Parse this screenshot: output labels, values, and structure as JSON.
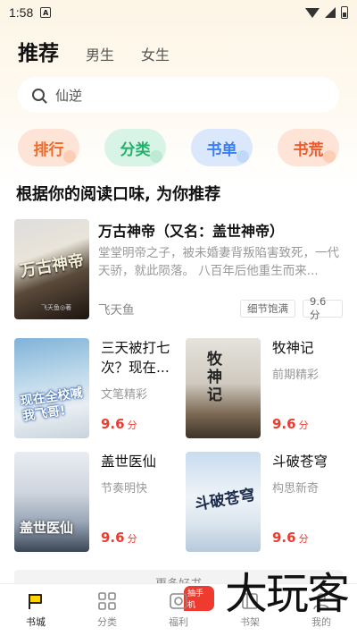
{
  "status_bar": {
    "time": "1:58",
    "app_icon": "A"
  },
  "header": {
    "tabs": [
      {
        "label": "推荐",
        "active": true
      },
      {
        "label": "男生",
        "active": false
      },
      {
        "label": "女生",
        "active": false
      }
    ]
  },
  "search": {
    "value": "仙逆"
  },
  "pills": [
    {
      "label": "排行"
    },
    {
      "label": "分类"
    },
    {
      "label": "书单"
    },
    {
      "label": "书荒"
    }
  ],
  "section_title": "根据你的阅读口味, 为你推荐",
  "featured": {
    "title": "万古神帝（又名：盖世神帝）",
    "description": "堂堂明帝之子，被未婚妻背叛陷害致死，一代天骄，就此陨落。 八百年后他重生而来...",
    "author": "飞天鱼",
    "tags": [
      "细节饱满",
      "9.6分"
    ],
    "cover_title": "万古神帝",
    "cover_author": "飞天鱼◎著"
  },
  "books": [
    {
      "title": "三天被打七次？现在...",
      "meta": "文笔精彩",
      "score": "9.6",
      "unit": "分",
      "cover_title": "现在全校喊我飞哥!"
    },
    {
      "title": "牧神记",
      "meta": "前期精彩",
      "score": "9.6",
      "unit": "分",
      "cover_title": "牧神记"
    },
    {
      "title": "盖世医仙",
      "meta": "节奏明快",
      "score": "9.6",
      "unit": "分",
      "cover_title": "盖世医仙"
    },
    {
      "title": "斗破苍穹",
      "meta": "构思新奇",
      "score": "9.6",
      "unit": "分",
      "cover_title": "斗破苍穹"
    }
  ],
  "more_label": "更多好书",
  "bottom_nav": [
    {
      "label": "书城",
      "active": true
    },
    {
      "label": "分类",
      "active": false
    },
    {
      "label": "福利",
      "active": false,
      "badge": "抽手机"
    },
    {
      "label": "书架",
      "active": false
    },
    {
      "label": "我的",
      "active": false
    }
  ],
  "watermark": "大玩客"
}
